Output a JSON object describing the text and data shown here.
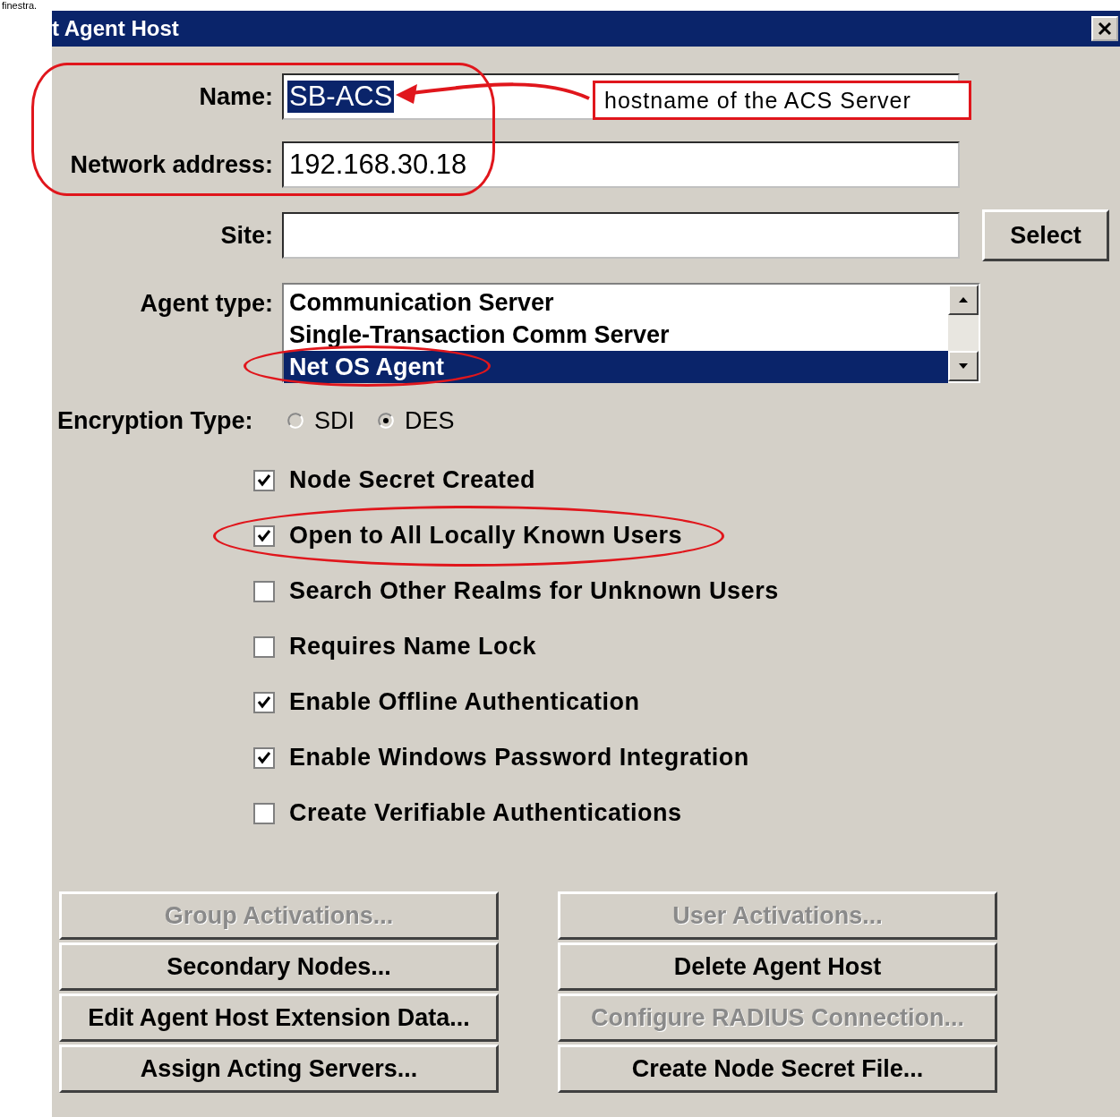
{
  "page_text": "finestra.",
  "window": {
    "title": "t Agent Host"
  },
  "fields": [
    {
      "label": "Name:",
      "value": "SB-ACS",
      "value_selected": true
    },
    {
      "label": "Network address:",
      "value": "192.168.30.18",
      "value_selected": false
    },
    {
      "label": "Site:",
      "button": "Select"
    }
  ],
  "agent_type": {
    "label": "Agent type:",
    "items": [
      {
        "label": "Communication Server",
        "selected": false
      },
      {
        "label": "Single-Transaction Comm Server",
        "selected": false
      },
      {
        "label": "Net OS Agent",
        "selected": true
      }
    ]
  },
  "encryption": {
    "label": "Encryption Type:",
    "options": [
      {
        "label": "SDI",
        "selected": false
      },
      {
        "label": "DES",
        "selected": true
      }
    ]
  },
  "checkboxes": [
    {
      "label": "Node Secret Created",
      "checked": true
    },
    {
      "label": "Open to All Locally Known Users",
      "checked": true
    },
    {
      "label": "Search Other Realms for Unknown Users",
      "checked": false
    },
    {
      "label": "Requires Name Lock",
      "checked": false
    },
    {
      "label": "Enable Offline Authentication",
      "checked": true
    },
    {
      "label": "Enable Windows Password Integration",
      "checked": true
    },
    {
      "label": "Create Verifiable Authentications",
      "checked": false
    }
  ],
  "buttons": [
    {
      "label": "Group Activations...",
      "disabled": true
    },
    {
      "label": "User Activations...",
      "disabled": true
    },
    {
      "label": "Secondary Nodes...",
      "disabled": false
    },
    {
      "label": "Delete Agent Host",
      "disabled": false
    },
    {
      "label": "Edit Agent Host Extension Data...",
      "disabled": false
    },
    {
      "label": "Configure RADIUS Connection...",
      "disabled": true
    },
    {
      "label": "Assign Acting Servers...",
      "disabled": false
    },
    {
      "label": "Create Node Secret File...",
      "disabled": false
    }
  ],
  "annotation": {
    "callout": "hostname of the ACS Server"
  }
}
